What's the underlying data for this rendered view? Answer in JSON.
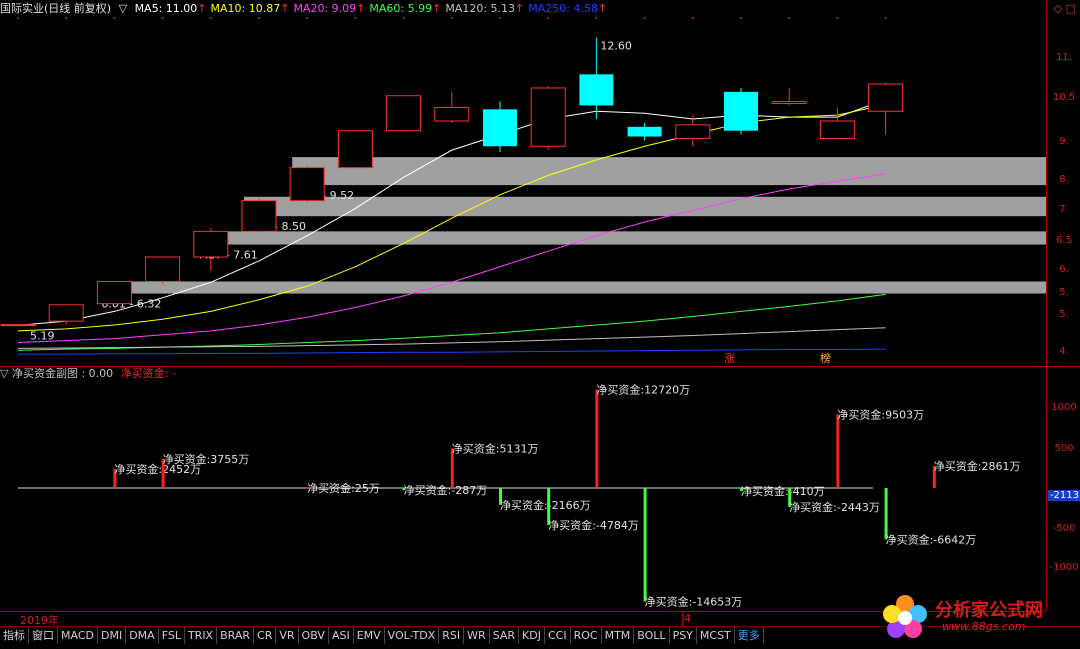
{
  "header": {
    "stock_title": "国际实业(日线 前复权)",
    "ma_indicator": "▽",
    "ma_items": [
      {
        "label": "MA5: 11.00",
        "color": "#ffffff"
      },
      {
        "label": "MA10: 10.87",
        "color": "#ffff00"
      },
      {
        "label": "MA20: 9.09",
        "color": "#ff40ff"
      },
      {
        "label": "MA60: 5.99",
        "color": "#40ff40"
      },
      {
        "label": "MA120: 5.13",
        "color": "#c0c0c0"
      },
      {
        "label": "MA250: 4.58",
        "color": "#2040ff"
      }
    ],
    "up_arrow": "↑"
  },
  "main_axis": {
    "ticks": [
      "11.",
      "10.5",
      "9.",
      "8.",
      "7.",
      "6.5",
      "6.",
      "5.",
      "5.",
      "4."
    ]
  },
  "price_annotations": {
    "max_label": "12.60",
    "min_label": "5.19",
    "zones": [
      "6.01 - 6.32",
      "7.27 - 7.61",
      "8.00 - 8.50",
      "8.80 - 9.52"
    ]
  },
  "markers": {
    "zhang": "涨",
    "bang": "榜"
  },
  "chart_data": [
    {
      "type": "candlestick",
      "title": "国际实业(日线 前复权)",
      "candles": [
        {
          "o": 5.19,
          "h": 5.22,
          "l": 5.16,
          "c": 5.21
        },
        {
          "o": 5.3,
          "h": 5.7,
          "l": 5.22,
          "c": 5.72
        },
        {
          "o": 5.75,
          "h": 6.32,
          "l": 5.74,
          "c": 6.32
        },
        {
          "o": 6.32,
          "h": 6.9,
          "l": 6.25,
          "c": 6.95
        },
        {
          "o": 6.95,
          "h": 7.7,
          "l": 6.6,
          "c": 7.61
        },
        {
          "o": 7.61,
          "h": 8.45,
          "l": 7.58,
          "c": 8.4
        },
        {
          "o": 8.4,
          "h": 9.3,
          "l": 8.35,
          "c": 9.25
        },
        {
          "o": 9.25,
          "h": 10.2,
          "l": 9.25,
          "c": 10.2
        },
        {
          "o": 10.2,
          "h": 11.1,
          "l": 10.18,
          "c": 11.1
        },
        {
          "o": 10.45,
          "h": 11.2,
          "l": 10.4,
          "c": 10.8
        },
        {
          "o": 10.75,
          "h": 10.95,
          "l": 9.65,
          "c": 9.8
        },
        {
          "o": 9.8,
          "h": 11.35,
          "l": 9.7,
          "c": 11.3
        },
        {
          "o": 11.65,
          "h": 12.6,
          "l": 10.5,
          "c": 10.85
        },
        {
          "o": 10.3,
          "h": 10.4,
          "l": 9.95,
          "c": 10.05
        },
        {
          "o": 10.0,
          "h": 10.6,
          "l": 9.8,
          "c": 10.35
        },
        {
          "o": 11.2,
          "h": 11.3,
          "l": 10.1,
          "c": 10.2
        },
        {
          "o": 10.9,
          "h": 11.3,
          "l": 10.85,
          "c": 10.95
        },
        {
          "o": 10.0,
          "h": 10.8,
          "l": 10.0,
          "c": 10.45
        },
        {
          "o": 10.7,
          "h": 11.45,
          "l": 10.1,
          "c": 11.4
        }
      ],
      "ma_series": [
        {
          "name": "MA5",
          "color": "#ffffff",
          "values": [
            5.19,
            5.3,
            5.55,
            5.9,
            6.3,
            6.85,
            7.5,
            8.2,
            9.0,
            9.7,
            10.1,
            10.5,
            10.7,
            10.65,
            10.5,
            10.6,
            10.55,
            10.55,
            11.0
          ]
        },
        {
          "name": "MA10",
          "color": "#ffff00",
          "values": [
            5.05,
            5.1,
            5.2,
            5.35,
            5.55,
            5.85,
            6.2,
            6.7,
            7.3,
            7.95,
            8.55,
            9.05,
            9.45,
            9.8,
            10.1,
            10.4,
            10.55,
            10.6,
            10.87
          ]
        },
        {
          "name": "MA20",
          "color": "#ff40ff",
          "values": [
            4.75,
            4.8,
            4.85,
            4.95,
            5.05,
            5.2,
            5.4,
            5.65,
            5.95,
            6.3,
            6.7,
            7.1,
            7.5,
            7.85,
            8.15,
            8.45,
            8.7,
            8.9,
            9.09
          ]
        },
        {
          "name": "MA60",
          "color": "#40ff40",
          "values": [
            4.55,
            4.58,
            4.6,
            4.63,
            4.66,
            4.7,
            4.75,
            4.8,
            4.86,
            4.93,
            5.0,
            5.1,
            5.2,
            5.3,
            5.42,
            5.55,
            5.68,
            5.82,
            5.99
          ]
        },
        {
          "name": "MA120",
          "color": "#c0c0c0",
          "values": [
            4.6,
            4.61,
            4.62,
            4.63,
            4.64,
            4.65,
            4.67,
            4.69,
            4.71,
            4.74,
            4.77,
            4.81,
            4.85,
            4.89,
            4.93,
            4.98,
            5.03,
            5.08,
            5.13
          ]
        },
        {
          "name": "MA250",
          "color": "#2040ff",
          "values": [
            4.45,
            4.45,
            4.46,
            4.46,
            4.47,
            4.47,
            4.48,
            4.49,
            4.5,
            4.5,
            4.51,
            4.52,
            4.53,
            4.54,
            4.55,
            4.56,
            4.57,
            4.57,
            4.58
          ]
        }
      ],
      "zones": [
        {
          "lo": 6.01,
          "hi": 6.32,
          "start_index": 2
        },
        {
          "lo": 7.27,
          "hi": 7.61,
          "start_index": 4
        },
        {
          "lo": 8.0,
          "hi": 8.5,
          "start_index": 5
        },
        {
          "lo": 8.8,
          "hi": 9.52,
          "start_index": 6
        }
      ],
      "ylim": [
        4.3,
        13.1
      ]
    },
    {
      "type": "bar",
      "title": "净买资金副图",
      "series_name": "净买资金",
      "unit": "万",
      "values": [
        2452,
        3755,
        25,
        -287,
        5131,
        -2166,
        -4784,
        12720,
        -14653,
        -410,
        -2443,
        9503,
        -6642,
        2861
      ],
      "positions": [
        2,
        3,
        6,
        8,
        9,
        10,
        11,
        12,
        13,
        15,
        16,
        17,
        18,
        19
      ],
      "ylim": [
        -15000,
        15000
      ]
    }
  ],
  "sub_header": {
    "title": "▽ 净买资金副图 : 0.00",
    "series": "净买资金:",
    "series_val": " -"
  },
  "sub_labels": [
    "净买资金:2452万",
    "净买资金:3755万",
    "净买资金:25万",
    "净买资金:-287万",
    "净买资金:5131万",
    "净买资金:-2166万",
    "净买资金:-4784万",
    "净买资金:12720万",
    "净买资金:-14653万",
    "净买资金:-410万",
    "净买资金:-2443万",
    "净买资金:9503万",
    "净买资金:-6642万",
    "净买资金:2861万"
  ],
  "sub_axis": {
    "ticks": [
      "1000",
      "500",
      "-500",
      "-1000"
    ],
    "badge": "-2113"
  },
  "year_bar": {
    "year": "2019年",
    "month": "4"
  },
  "toolbar": {
    "items": [
      "指标",
      "窗口",
      "MACD",
      "DMI",
      "DMA",
      "FSL",
      "TRIX",
      "BRAR",
      "CR",
      "VR",
      "OBV",
      "ASI",
      "EMV",
      "VOL-TDX",
      "RSI",
      "WR",
      "SAR",
      "KDJ",
      "CCI",
      "ROC",
      "MTM",
      "BOLL",
      "PSY",
      "MCST",
      "更多"
    ]
  },
  "logo": {
    "text": "分析家公式网",
    "url": "www.88gs.com"
  },
  "colors": {
    "up": "#ff3030",
    "down": "#00ffff",
    "neg_bar": "#40ff40",
    "pos_bar": "#ff2020",
    "zone": "#a0a0a0"
  }
}
